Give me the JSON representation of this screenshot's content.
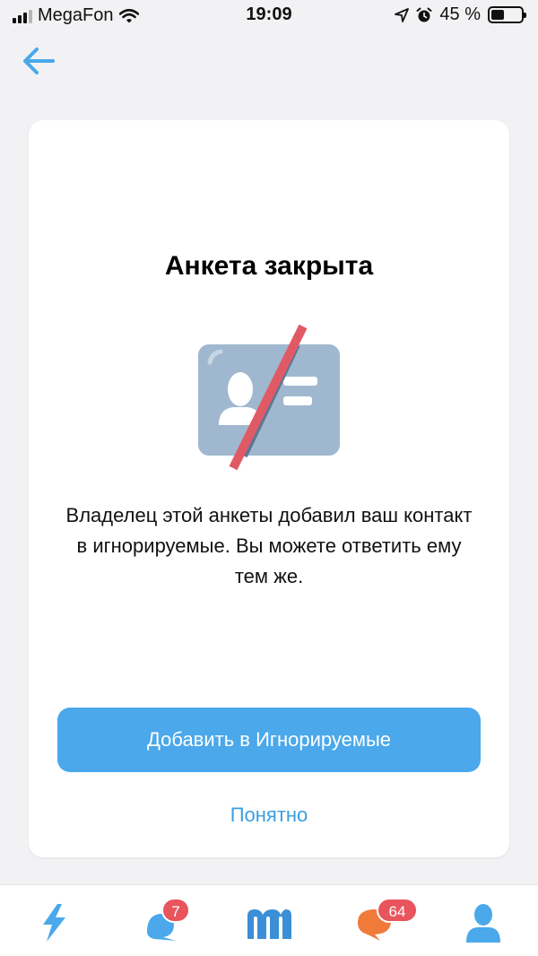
{
  "status_bar": {
    "carrier": "MegaFon",
    "time": "19:09",
    "battery_percent": "45 %",
    "battery_level": 0.45
  },
  "card": {
    "title": "Анкета закрыта",
    "message": "Владелец этой анкеты добавил ваш контакт в игнорируемые. Вы можете ответить ему тем же.",
    "primary_button_label": "Добавить в Игнорируемые",
    "dismiss_label": "Понятно"
  },
  "bottom_nav": {
    "items": [
      {
        "icon": "lightning-icon"
      },
      {
        "icon": "notifications-icon",
        "badge": "7"
      },
      {
        "icon": "mamba-logo-icon"
      },
      {
        "icon": "chat-icon",
        "badge": "64"
      },
      {
        "icon": "profile-icon"
      }
    ]
  },
  "colors": {
    "accent": "#4aa8eb",
    "link": "#3b9de0",
    "badge": "#e8555d",
    "strike": "#e05a66",
    "illustration": "#9fb8cf"
  }
}
